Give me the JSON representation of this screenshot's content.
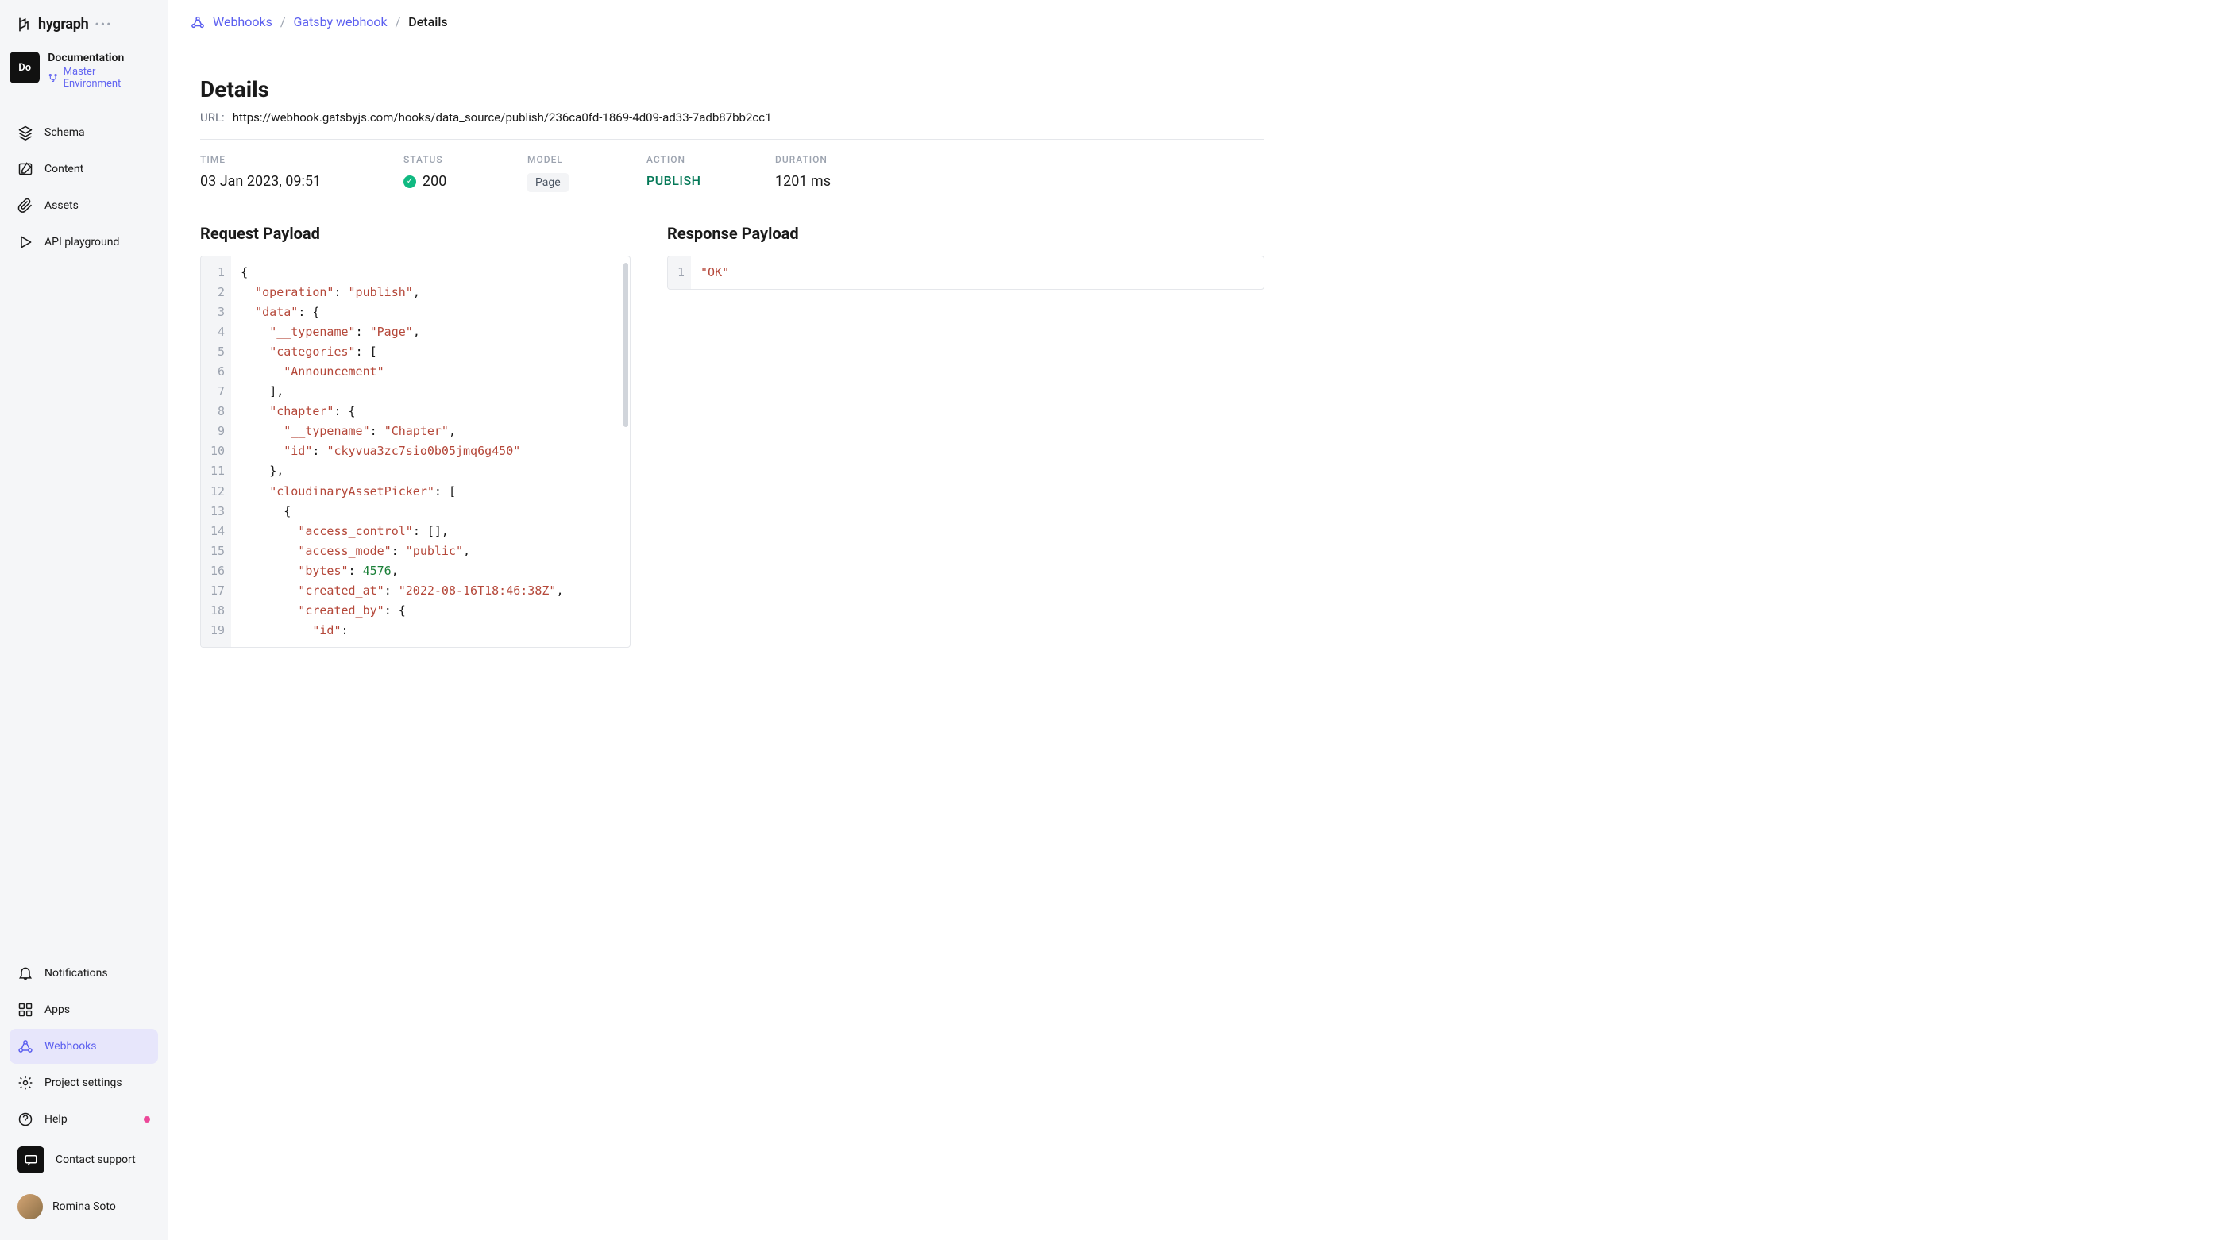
{
  "brand": "hygraph",
  "project": {
    "badge": "Do",
    "name": "Documentation",
    "env": "Master Environment"
  },
  "nav": {
    "schema": "Schema",
    "content": "Content",
    "assets": "Assets",
    "playground": "API playground",
    "notifications": "Notifications",
    "apps": "Apps",
    "webhooks": "Webhooks",
    "project_settings": "Project settings",
    "help": "Help",
    "contact": "Contact support"
  },
  "user": {
    "name": "Romina Soto"
  },
  "breadcrumb": {
    "root": "Webhooks",
    "parent": "Gatsby webhook",
    "current": "Details"
  },
  "details": {
    "title": "Details",
    "url_label": "URL:",
    "url": "https://webhook.gatsbyjs.com/hooks/data_source/publish/236ca0fd-1869-4d09-ad33-7adb87bb2cc1",
    "labels": {
      "time": "TIME",
      "status": "STATUS",
      "model": "MODEL",
      "action": "ACTION",
      "duration": "DURATION"
    },
    "time": "03 Jan 2023, 09:51",
    "status": "200",
    "model": "Page",
    "action": "PUBLISH",
    "duration": "1201 ms"
  },
  "request": {
    "title": "Request Payload",
    "lines": [
      [
        [
          "punc",
          "{"
        ]
      ],
      [
        [
          "sp",
          "  "
        ],
        [
          "key",
          "\"operation\""
        ],
        [
          "punc",
          ": "
        ],
        [
          "str",
          "\"publish\""
        ],
        [
          "punc",
          ","
        ]
      ],
      [
        [
          "sp",
          "  "
        ],
        [
          "key",
          "\"data\""
        ],
        [
          "punc",
          ": {"
        ]
      ],
      [
        [
          "sp",
          "    "
        ],
        [
          "key",
          "\"__typename\""
        ],
        [
          "punc",
          ": "
        ],
        [
          "str",
          "\"Page\""
        ],
        [
          "punc",
          ","
        ]
      ],
      [
        [
          "sp",
          "    "
        ],
        [
          "key",
          "\"categories\""
        ],
        [
          "punc",
          ": ["
        ]
      ],
      [
        [
          "sp",
          "      "
        ],
        [
          "str",
          "\"Announcement\""
        ]
      ],
      [
        [
          "sp",
          "    "
        ],
        [
          "punc",
          "],"
        ]
      ],
      [
        [
          "sp",
          "    "
        ],
        [
          "key",
          "\"chapter\""
        ],
        [
          "punc",
          ": {"
        ]
      ],
      [
        [
          "sp",
          "      "
        ],
        [
          "key",
          "\"__typename\""
        ],
        [
          "punc",
          ": "
        ],
        [
          "str",
          "\"Chapter\""
        ],
        [
          "punc",
          ","
        ]
      ],
      [
        [
          "sp",
          "      "
        ],
        [
          "key",
          "\"id\""
        ],
        [
          "punc",
          ": "
        ],
        [
          "str",
          "\"ckyvua3zc7sio0b05jmq6g450\""
        ]
      ],
      [
        [
          "sp",
          "    "
        ],
        [
          "punc",
          "},"
        ]
      ],
      [
        [
          "sp",
          "    "
        ],
        [
          "key",
          "\"cloudinaryAssetPicker\""
        ],
        [
          "punc",
          ": ["
        ]
      ],
      [
        [
          "sp",
          "      "
        ],
        [
          "punc",
          "{"
        ]
      ],
      [
        [
          "sp",
          "        "
        ],
        [
          "key",
          "\"access_control\""
        ],
        [
          "punc",
          ": [],"
        ]
      ],
      [
        [
          "sp",
          "        "
        ],
        [
          "key",
          "\"access_mode\""
        ],
        [
          "punc",
          ": "
        ],
        [
          "str",
          "\"public\""
        ],
        [
          "punc",
          ","
        ]
      ],
      [
        [
          "sp",
          "        "
        ],
        [
          "key",
          "\"bytes\""
        ],
        [
          "punc",
          ": "
        ],
        [
          "num",
          "4576"
        ],
        [
          "punc",
          ","
        ]
      ],
      [
        [
          "sp",
          "        "
        ],
        [
          "key",
          "\"created_at\""
        ],
        [
          "punc",
          ": "
        ],
        [
          "str",
          "\"2022-08-16T18:46:38Z\""
        ],
        [
          "punc",
          ","
        ]
      ],
      [
        [
          "sp",
          "        "
        ],
        [
          "key",
          "\"created_by\""
        ],
        [
          "punc",
          ": {"
        ]
      ],
      [
        [
          "sp",
          "          "
        ],
        [
          "key",
          "\"id\""
        ],
        [
          "punc",
          ":"
        ]
      ]
    ]
  },
  "response": {
    "title": "Response Payload",
    "lines": [
      [
        [
          "str",
          "\"OK\""
        ]
      ]
    ]
  }
}
